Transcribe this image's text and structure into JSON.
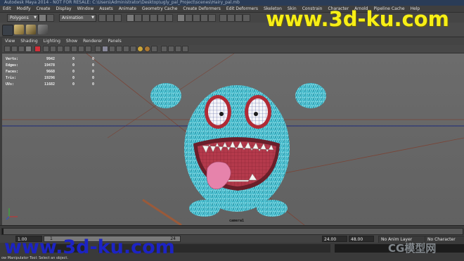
{
  "window": {
    "title": "Autodesk Maya 2014 - NOT FOR RESALE: C:\\Users\\Administrator\\Desktop\\ugly_pal_Project\\scenes\\Hairy_pal.mb"
  },
  "watermarks": {
    "top": "www.3d-ku.com",
    "bottom": "www.3d-ku.com",
    "corner": "CG模型网"
  },
  "menu": {
    "items": [
      "Edit",
      "Modify",
      "Create",
      "Display",
      "Window",
      "Assets",
      "Animate",
      "Geometry Cache",
      "Create Deformers",
      "Edit Deformers",
      "Skeleton",
      "Skin",
      "Constrain",
      "Character",
      "Arnold",
      "Pipeline Cache",
      "Help"
    ]
  },
  "status_line": {
    "menuset": "Polygons",
    "mode": "Animation"
  },
  "panel": {
    "menu": [
      "View",
      "Shading",
      "Lighting",
      "Show",
      "Renderer",
      "Panels"
    ]
  },
  "hud": {
    "rows": [
      {
        "label": "Verts:",
        "values": [
          "9942",
          "0",
          "0"
        ]
      },
      {
        "label": "Edges:",
        "values": [
          "19478",
          "0",
          "0"
        ]
      },
      {
        "label": "Faces:",
        "values": [
          "9668",
          "0",
          "0"
        ]
      },
      {
        "label": "Tris:",
        "values": [
          "19296",
          "0",
          "0"
        ]
      },
      {
        "label": "UVs:",
        "values": [
          "11682",
          "0",
          "0"
        ]
      }
    ]
  },
  "viewport": {
    "camera_label": "camera1"
  },
  "time_slider": {
    "start": "1.00",
    "current_frame": "1",
    "end_tick": "24",
    "range_end": "24.00",
    "anim_end": "48.00",
    "anim_layer": "No Anim Layer",
    "character_set": "No Character Set"
  },
  "help_line": {
    "text": "ow Manipulator Tool: Select an object."
  },
  "colors": {
    "fur": "#3fb8c8",
    "mouth": "#b23a4a",
    "tongue": "#e07aa0",
    "title_bar": "#2a3c57"
  }
}
